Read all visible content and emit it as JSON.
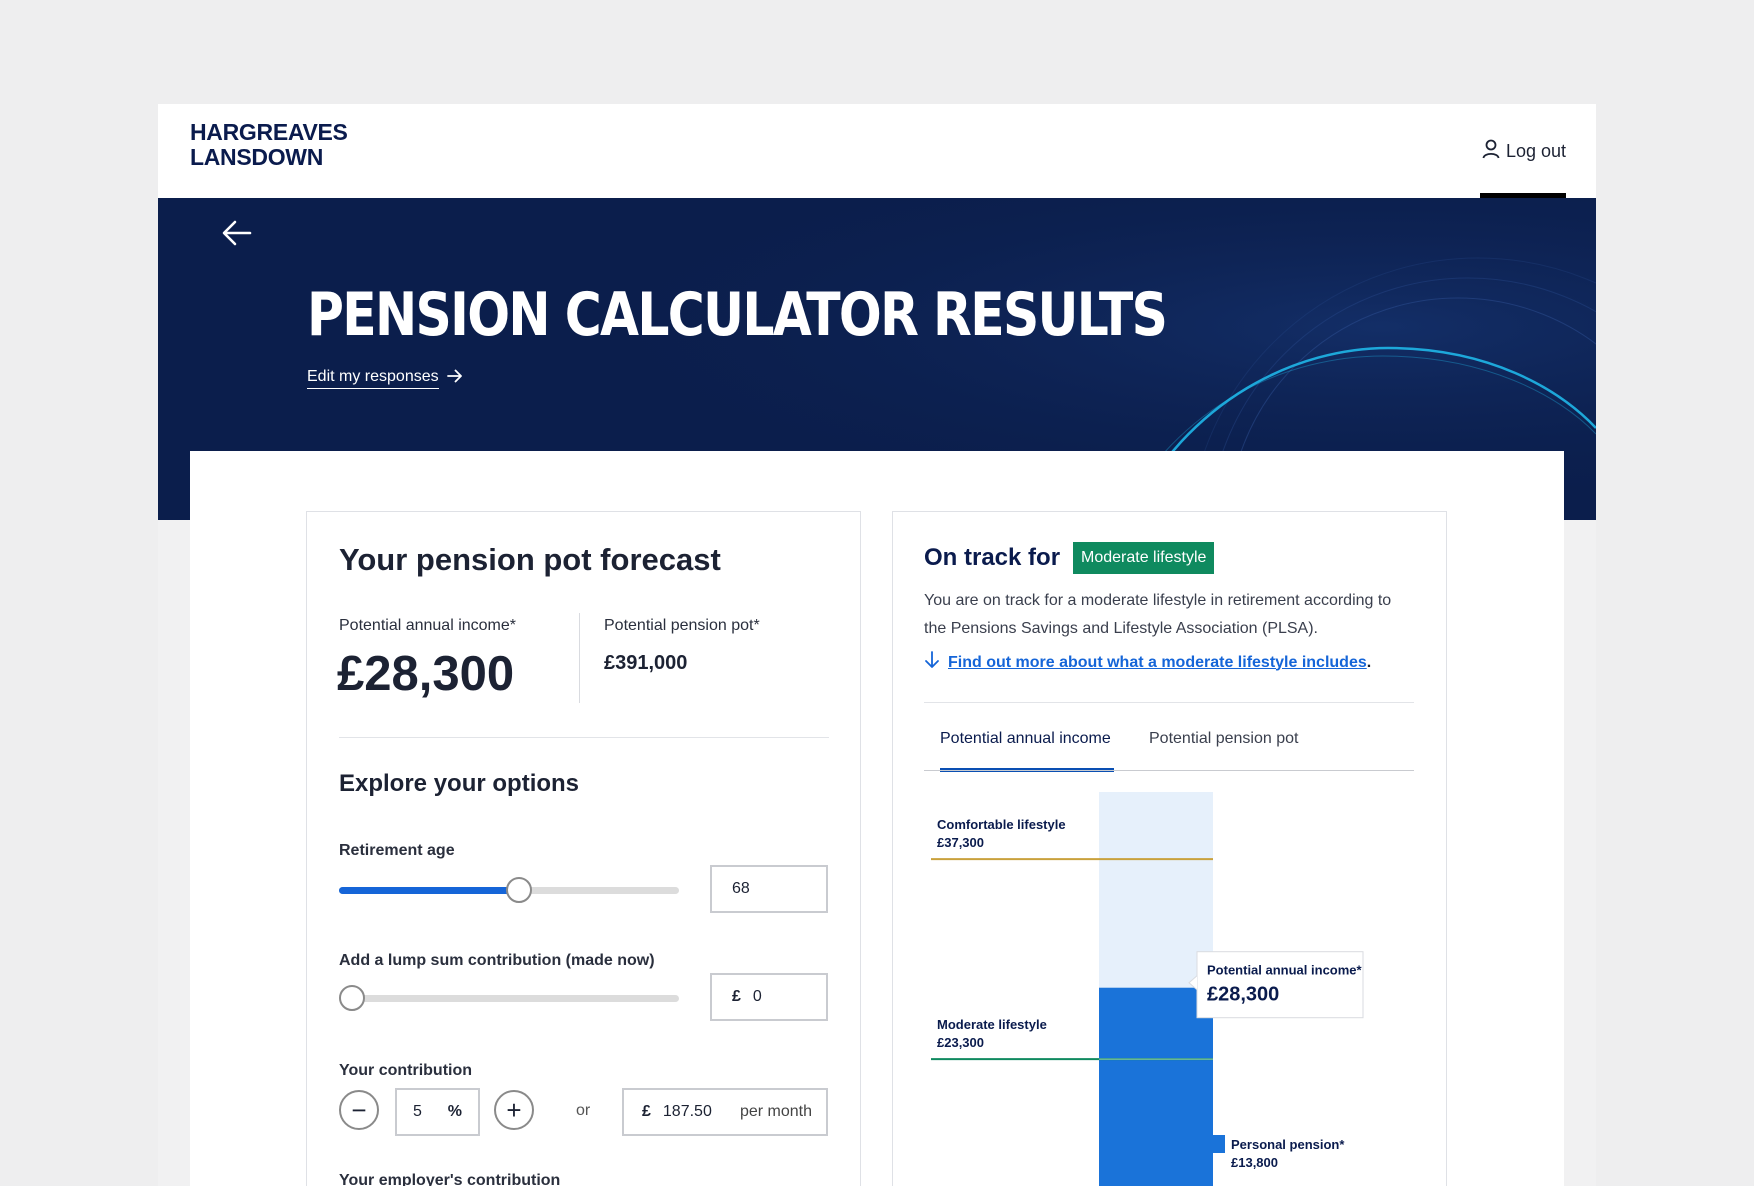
{
  "brand": {
    "line1": "HARGREAVES",
    "line2": "LANSDOWN"
  },
  "header": {
    "logout_label": "Log out"
  },
  "hero": {
    "title": "PENSION CALCULATOR RESULTS",
    "edit_link": "Edit my responses"
  },
  "forecast": {
    "title": "Your pension pot forecast",
    "income_label": "Potential annual income*",
    "income_value": "£28,300",
    "pot_label": "Potential pension pot*",
    "pot_value": "£391,000"
  },
  "options": {
    "title": "Explore your options",
    "retirement_age": {
      "label": "Retirement age",
      "value": "68",
      "slider_fraction": 0.53
    },
    "lump_sum": {
      "label": "Add a lump sum contribution (made now)",
      "currency": "£",
      "value": "0",
      "slider_fraction": 0.0
    },
    "contribution": {
      "label": "Your contribution",
      "percent_value": "5",
      "percent_symbol": "%",
      "or": "or",
      "currency": "£",
      "amount": "187.50",
      "per": "per month",
      "minus": "−",
      "plus": "+"
    },
    "employer_label": "Your employer's contribution"
  },
  "track": {
    "prefix": "On track for",
    "badge": "Moderate lifestyle",
    "description": "You are on track for a moderate lifestyle in retirement according to the Pensions Savings and Lifestyle Association (PLSA).",
    "line1": "You are on track for a moderate lifestyle in retirement according to",
    "line2": "the Pensions Savings and Lifestyle Association (PLSA).",
    "link": "Find out more about what a moderate lifestyle includes",
    "link_suffix": ".",
    "tabs": [
      "Potential annual income",
      "Potential pension pot"
    ],
    "active_tab": 0
  },
  "chart_data": {
    "type": "bar",
    "markers": [
      {
        "name": "Comfortable lifestyle",
        "value": 37300,
        "label": "£37,300",
        "color": "#c9a13b"
      },
      {
        "name": "Moderate lifestyle",
        "value": 23300,
        "label": "£23,300",
        "color": "#0f8a5f"
      }
    ],
    "total": {
      "label": "Potential annual income*",
      "value": 28300,
      "display": "£28,300"
    },
    "segments": [
      {
        "name": "Personal pension*",
        "value": 13800,
        "display": "£13,800",
        "color": "#0a1b4d"
      }
    ],
    "colors": {
      "background": "#e6f0fb",
      "income": "#1a73d9"
    }
  }
}
